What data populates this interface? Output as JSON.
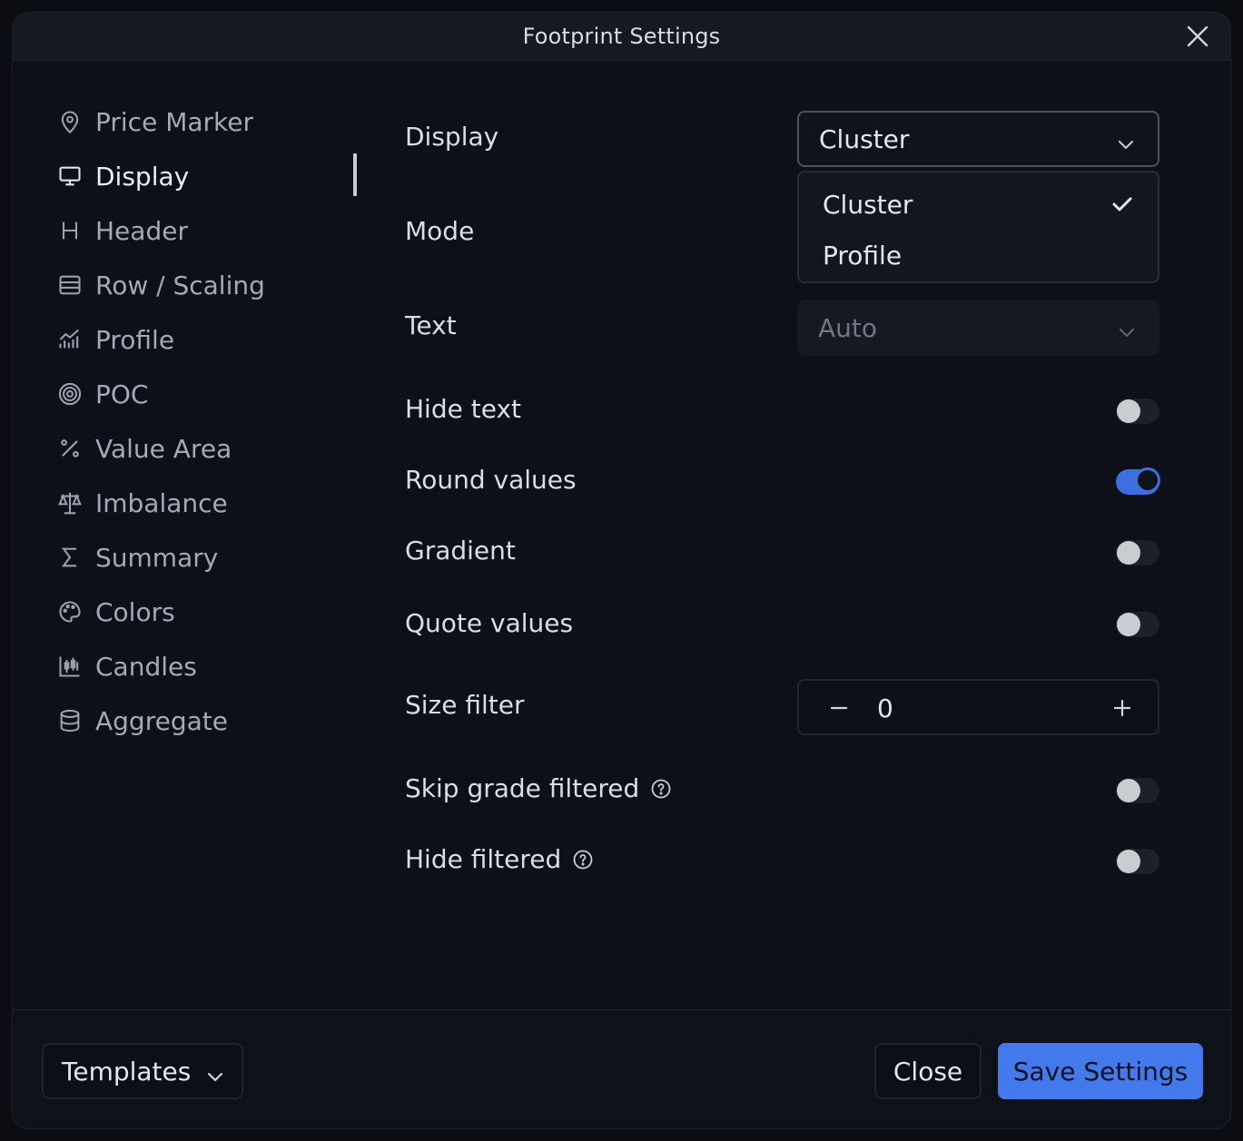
{
  "window": {
    "title": "Footprint Settings"
  },
  "sidebar": {
    "items": [
      {
        "label": "Price Marker",
        "icon": "map-pin-icon"
      },
      {
        "label": "Display",
        "icon": "monitor-icon",
        "active": true
      },
      {
        "label": "Header",
        "icon": "heading-icon"
      },
      {
        "label": "Row / Scaling",
        "icon": "rows-icon"
      },
      {
        "label": "Profile",
        "icon": "chart-icon"
      },
      {
        "label": "POC",
        "icon": "target-icon"
      },
      {
        "label": "Value Area",
        "icon": "percent-icon"
      },
      {
        "label": "Imbalance",
        "icon": "scale-icon"
      },
      {
        "label": "Summary",
        "icon": "sigma-icon"
      },
      {
        "label": "Colors",
        "icon": "palette-icon"
      },
      {
        "label": "Candles",
        "icon": "candles-icon"
      },
      {
        "label": "Aggregate",
        "icon": "database-icon"
      }
    ]
  },
  "settings": {
    "display": {
      "label": "Display",
      "value": "Cluster",
      "options": [
        "Cluster",
        "Profile"
      ],
      "selected_option": "Cluster"
    },
    "mode": {
      "label": "Mode"
    },
    "text": {
      "label": "Text",
      "value": "Auto"
    },
    "hide_text": {
      "label": "Hide text",
      "on": false
    },
    "round_values": {
      "label": "Round values",
      "on": true
    },
    "gradient": {
      "label": "Gradient",
      "on": false
    },
    "quote_values": {
      "label": "Quote values",
      "on": false
    },
    "size_filter": {
      "label": "Size filter",
      "value": "0"
    },
    "skip_grade_filtered": {
      "label": "Skip grade filtered",
      "on": false
    },
    "hide_filtered": {
      "label": "Hide filtered",
      "on": false
    }
  },
  "footer": {
    "templates_label": "Templates",
    "close_label": "Close",
    "save_label": "Save Settings"
  },
  "colors": {
    "accent": "#4479ec",
    "background": "#0d1018"
  }
}
